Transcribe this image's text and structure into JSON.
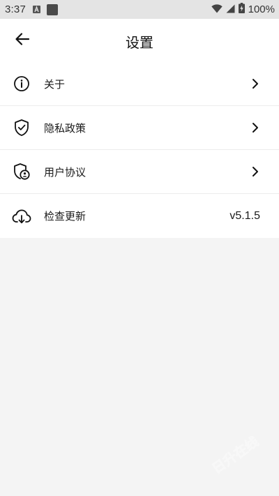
{
  "status_bar": {
    "time": "3:37",
    "battery": "100%"
  },
  "header": {
    "title": "设置"
  },
  "settings": [
    {
      "label": "关于",
      "icon": "info-icon"
    },
    {
      "label": "隐私政策",
      "icon": "shield-check-icon"
    },
    {
      "label": "用户协议",
      "icon": "shield-user-icon"
    },
    {
      "label": "检查更新",
      "icon": "cloud-download-icon",
      "value": "v5.1.5"
    }
  ],
  "watermark": {
    "text": "日升在线"
  }
}
